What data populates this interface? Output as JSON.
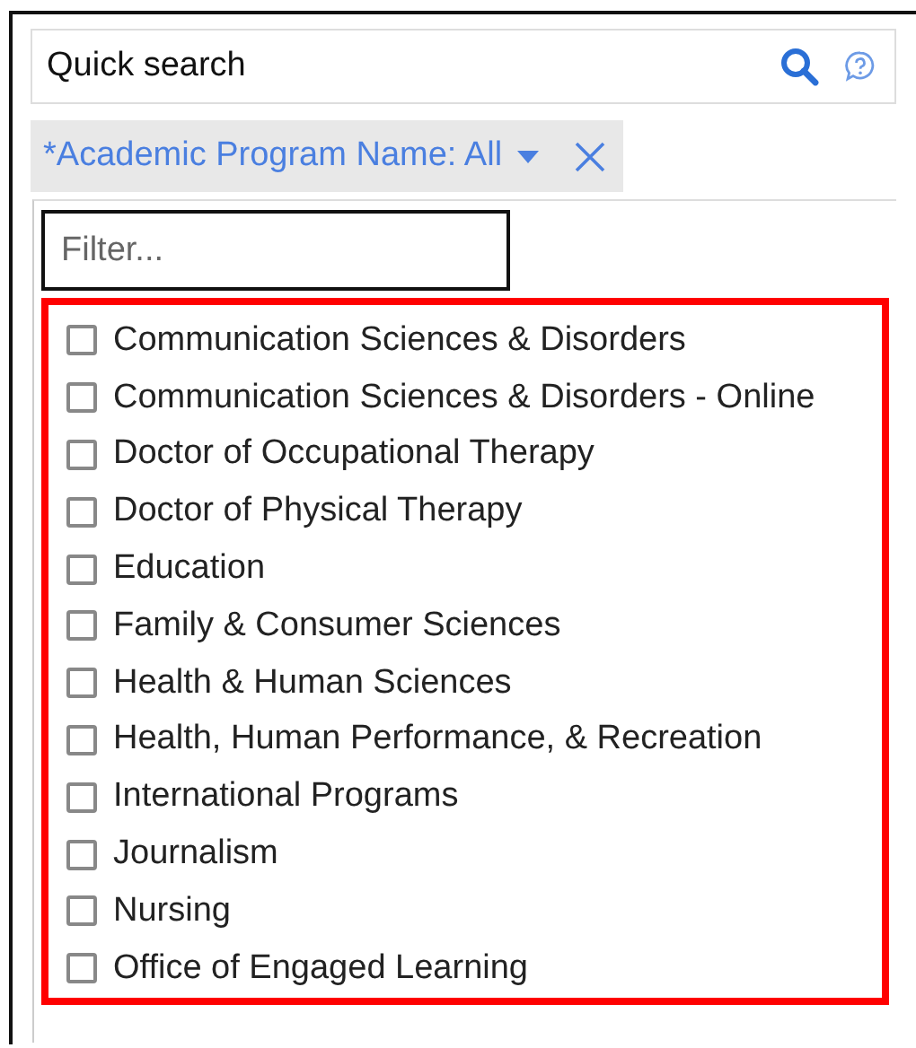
{
  "search": {
    "placeholder": "Quick search"
  },
  "filter_chip": {
    "label": "*Academic Program Name: All"
  },
  "dropdown": {
    "filter": {
      "placeholder": "Filter..."
    },
    "options": [
      {
        "label": "Communication Sciences & Disorders",
        "checked": false
      },
      {
        "label": "Communication Sciences & Disorders - Online",
        "checked": false
      },
      {
        "label": "Doctor of Occupational Therapy",
        "checked": false
      },
      {
        "label": "Doctor of Physical Therapy",
        "checked": false
      },
      {
        "label": "Education",
        "checked": false
      },
      {
        "label": "Family & Consumer Sciences",
        "checked": false
      },
      {
        "label": "Health & Human Sciences",
        "checked": false
      },
      {
        "label": "Health, Human Performance, & Recreation",
        "checked": false
      },
      {
        "label": "International Programs",
        "checked": false
      },
      {
        "label": "Journalism",
        "checked": false
      },
      {
        "label": "Nursing",
        "checked": false
      },
      {
        "label": "Office of Engaged Learning",
        "checked": false
      }
    ]
  }
}
